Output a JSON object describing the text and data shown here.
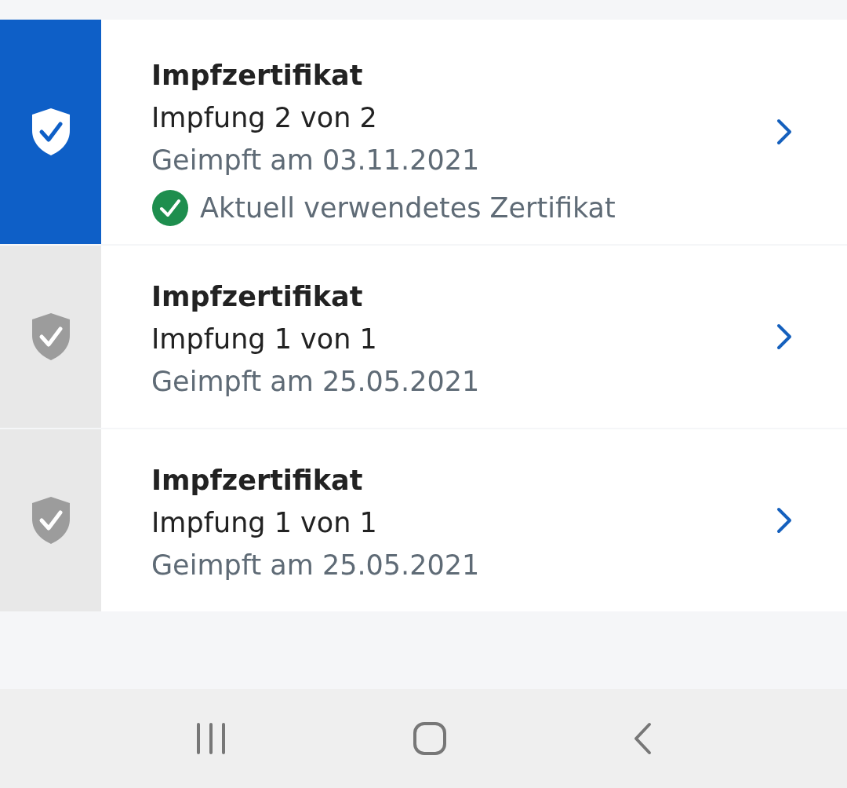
{
  "certificates": [
    {
      "title": "Impfzertifikat",
      "dose": "Impfung 2 von 2",
      "date": "Geimpft am 03.11.2021",
      "selected": true,
      "current_note": "Aktuell verwendetes Zertifikat"
    },
    {
      "title": "Impfzertifikat",
      "dose": "Impfung 1 von 1",
      "date": "Geimpft am 25.05.2021",
      "selected": false
    },
    {
      "title": "Impfzertifikat",
      "dose": "Impfung 1 von 1",
      "date": "Geimpft am 25.05.2021",
      "selected": false
    }
  ]
}
